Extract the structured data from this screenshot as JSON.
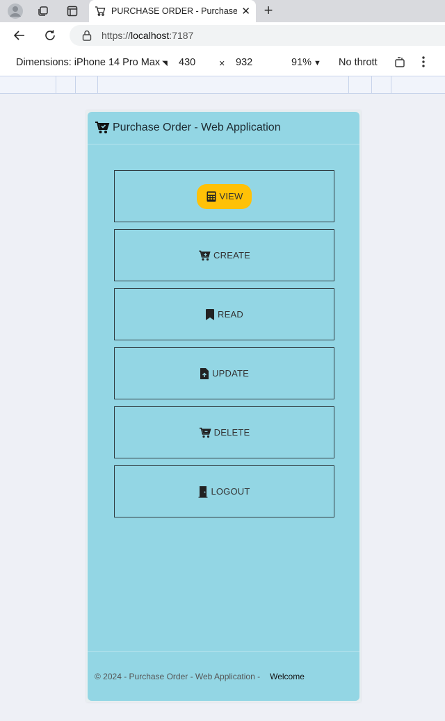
{
  "browser": {
    "tab_title": "PURCHASE ORDER - Purchase Order - Web Application",
    "url_scheme": "https://",
    "url_host": "localhost",
    "url_port": ":7187"
  },
  "devtools": {
    "dimensions_label": "Dimensions: iPhone 14 Pro Max",
    "width": "430",
    "times": "×",
    "height": "932",
    "zoom": "91%",
    "throttle": "No thrott"
  },
  "app": {
    "title": "Purchase Order - Web Application",
    "menu": [
      {
        "label": "VIEW",
        "icon": "table-icon"
      },
      {
        "label": "CREATE",
        "icon": "cart-add-icon"
      },
      {
        "label": "READ",
        "icon": "bookmark-icon"
      },
      {
        "label": "UPDATE",
        "icon": "file-upload-icon"
      },
      {
        "label": "DELETE",
        "icon": "cart-remove-icon"
      },
      {
        "label": "LOGOUT",
        "icon": "door-icon"
      }
    ],
    "footer_text": "© 2024 - Purchase Order - Web Application -",
    "footer_link": "Welcome",
    "accent_color": "#ffc107",
    "background_color": "#93d6e4"
  }
}
